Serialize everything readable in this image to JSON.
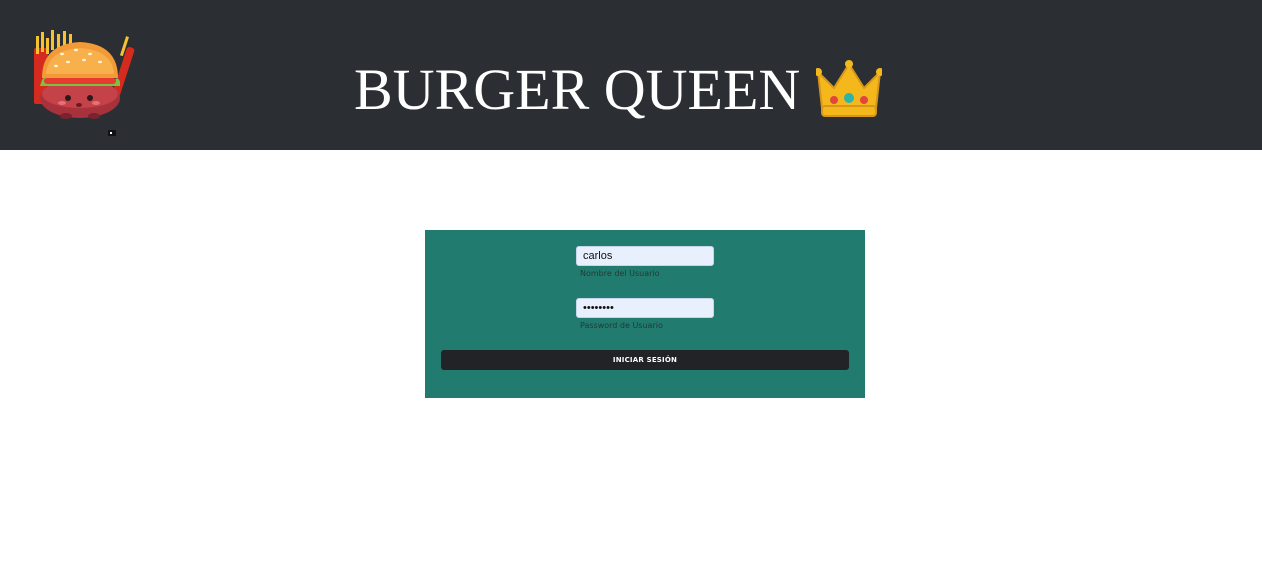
{
  "header": {
    "title": "BURGER QUEEN",
    "logo_icon": "burger-mascot-icon",
    "title_icon": "crown-icon",
    "background": "#2b2f33"
  },
  "login": {
    "username": {
      "value": "carlos",
      "label": "Nombre del Usuario"
    },
    "password": {
      "value": "carlosaa",
      "label": "Password de Usuario"
    },
    "submit_label": "INICIAR SESIÓN",
    "panel_color": "#227b6f",
    "input_bg": "#e8f0fe",
    "button_color": "#212327"
  }
}
